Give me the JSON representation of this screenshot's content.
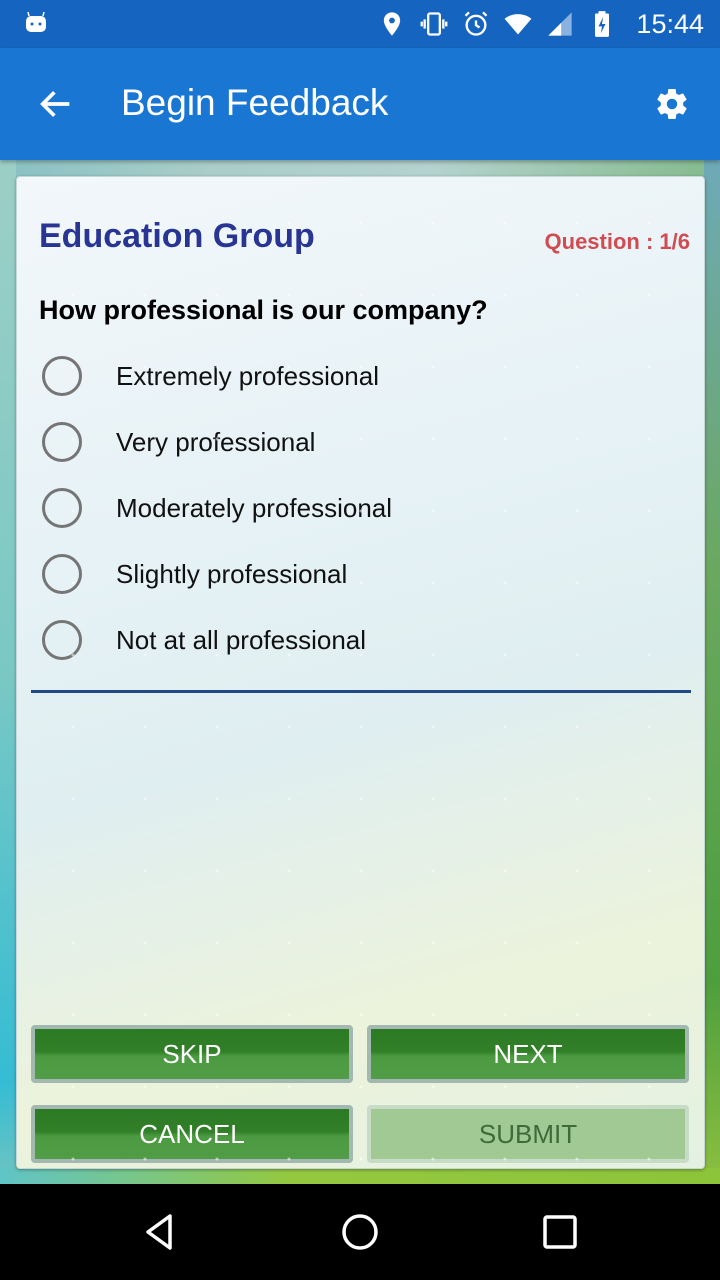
{
  "status_bar": {
    "time": "15:44",
    "icons": [
      "android-icon",
      "location-icon",
      "vibrate-icon",
      "alarm-icon",
      "wifi-icon",
      "signal-icon",
      "battery-charging-icon"
    ]
  },
  "app_bar": {
    "title": "Begin Feedback",
    "back_icon": "arrow-left-icon",
    "settings_icon": "gear-icon"
  },
  "survey": {
    "group_title": "Education Group",
    "question_counter": "Question : 1/6",
    "question": "How professional is our company?",
    "options": [
      {
        "label": "Extremely professional",
        "selected": false
      },
      {
        "label": "Very professional",
        "selected": false
      },
      {
        "label": "Moderately professional",
        "selected": false
      },
      {
        "label": "Slightly professional",
        "selected": false
      },
      {
        "label": "Not at all professional",
        "selected": false
      }
    ]
  },
  "buttons": {
    "skip": "SKIP",
    "next": "NEXT",
    "cancel": "CANCEL",
    "submit": "SUBMIT",
    "submit_enabled": false
  },
  "colors": {
    "app_bar": "#1976d2",
    "status_bar": "#1565c0",
    "group_title": "#283593",
    "question_counter": "#d04b52",
    "button_green": "#317f28",
    "divider": "#1f4a86"
  },
  "nav_bar": {
    "icons": [
      "nav-back-icon",
      "nav-home-icon",
      "nav-recents-icon"
    ]
  }
}
